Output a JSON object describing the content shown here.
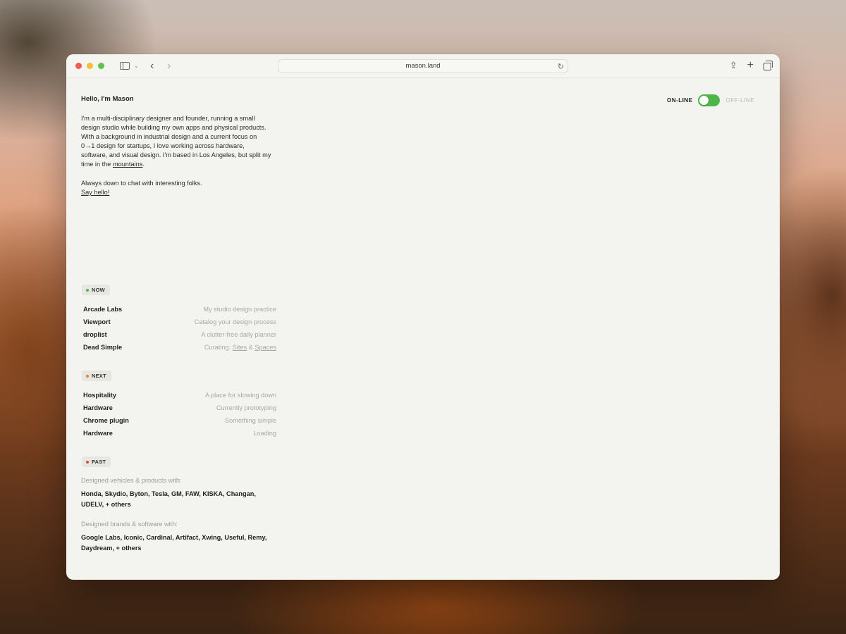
{
  "browser": {
    "url": "mason.land"
  },
  "intro": {
    "greeting": "Hello, I'm Mason",
    "bio_main": "I'm a multi-disciplinary designer and founder, running a small design studio while building my own apps and physical products. With a background in industrial design and a current focus on 0→1 design for startups, I love working across hardware, software, and visual design. I'm based in Los Angeles, but split my time in the ",
    "bio_link": "mountains",
    "bio_end": ".",
    "chat_line": "Always down to chat with interesting folks.",
    "say_hello": "Say hello!"
  },
  "status_toggle": {
    "on_label": "ON-LINE",
    "off_label": "OFF-LINE",
    "state": "on",
    "color": "#4cb648"
  },
  "now": {
    "label": "NOW",
    "dot_color": "#4cb648",
    "items": [
      {
        "title": "Arcade Labs",
        "desc": "My studio design practice"
      },
      {
        "title": "Viewport",
        "desc": "Catalog your design process"
      },
      {
        "title": "droplist",
        "desc": "A clutter-free daily planner"
      },
      {
        "title": "Dead Simple",
        "desc_prefix": "Curating: ",
        "link1": "Sites",
        "amp": " & ",
        "link2": "Spaces"
      }
    ]
  },
  "next": {
    "label": "NEXT",
    "dot_color": "#ea8030",
    "items": [
      {
        "title": "Hospitality",
        "desc": "A place for slowing down"
      },
      {
        "title": "Hardware",
        "desc": "Currently prototyping"
      },
      {
        "title": "Chrome plugin",
        "desc": "Something simple"
      },
      {
        "title": "Hardware",
        "desc": "Loading"
      }
    ]
  },
  "past": {
    "label": "PAST",
    "dot_color": "#d8503d",
    "vehicles_label": "Designed vehicles & products with:",
    "vehicles_list": "Honda, Skydio, Byton, Tesla, GM, FAW, KISKA, Changan, UDELV, + others",
    "brands_label": "Designed brands & software with:",
    "brands_list": "Google Labs, Iconic, Cardinal, Artifact, Xwing, Useful, Remy, Daydream, + others"
  }
}
